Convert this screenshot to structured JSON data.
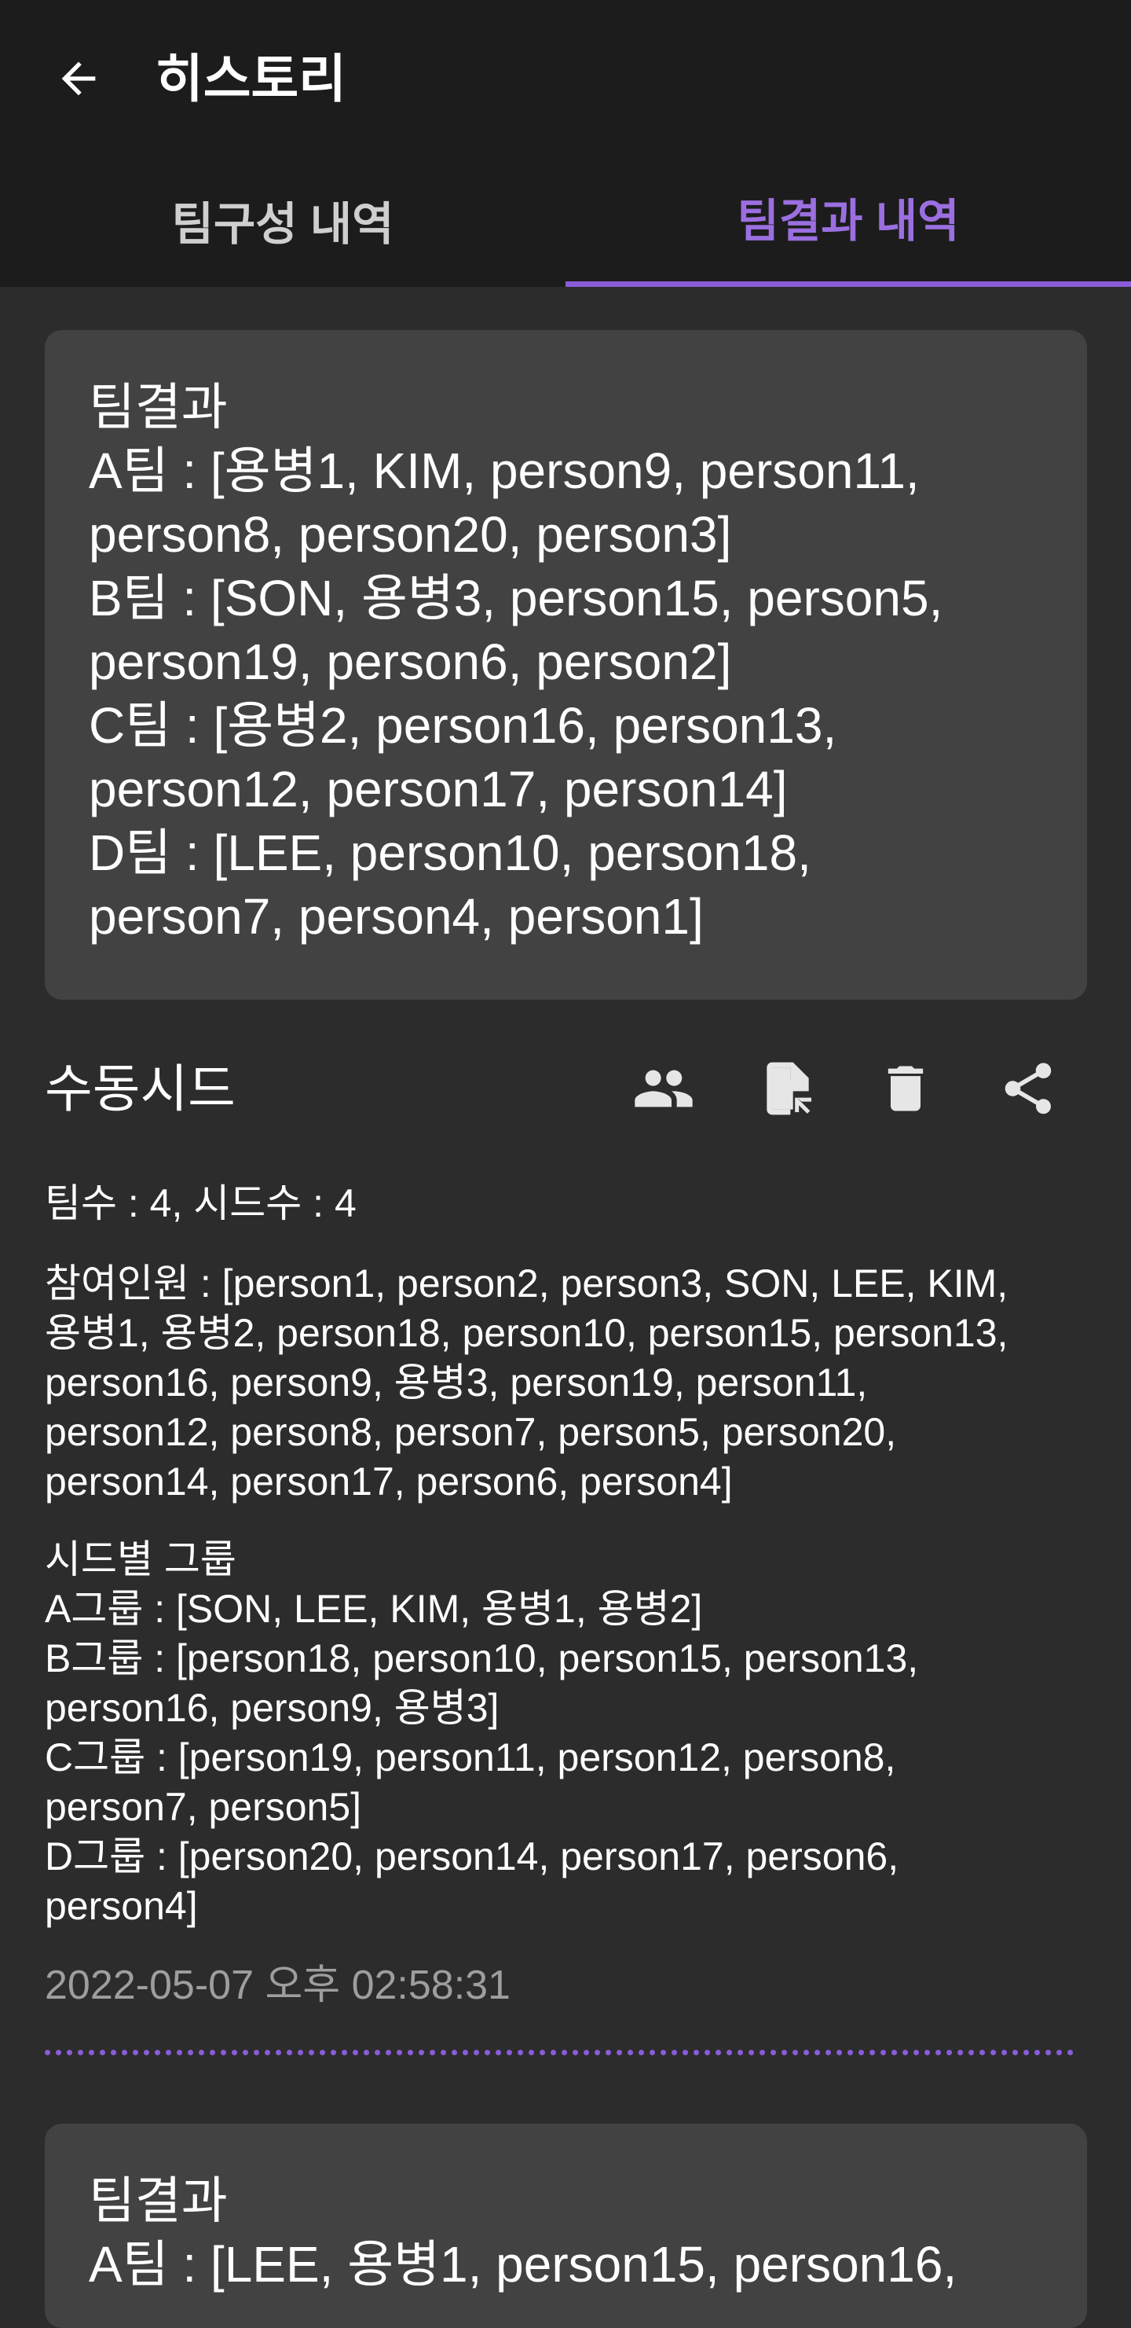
{
  "header": {
    "title": "히스토리",
    "back_icon": "arrow-back-icon"
  },
  "tabs": [
    {
      "label": "팀구성 내역",
      "active": false
    },
    {
      "label": "팀결과 내역",
      "active": true
    }
  ],
  "colors": {
    "accent": "#8a5cd9",
    "background": "#2c2c2c",
    "appbar": "#1c1c1c",
    "card": "#424242"
  },
  "result_card_1": {
    "text": "팀결과\nA팀 : [용병1, KIM, person9, person11,\nperson8, person20, person3]\nB팀 : [SON, 용병3, person15, person5,\nperson19, person6, person2]\nC팀 : [용병2, person16, person13,\nperson12, person17, person14]\nD팀 : [LEE, person10, person18,\nperson7, person4, person1]"
  },
  "section": {
    "title": "수동시드",
    "actions": [
      {
        "name": "group-icon"
      },
      {
        "name": "file-open-icon"
      },
      {
        "name": "delete-icon"
      },
      {
        "name": "share-icon"
      }
    ]
  },
  "info": {
    "counts": "팀수 : 4, 시드수 : 4",
    "participants": "참여인원 : [person1, person2, person3, SON, LEE, KIM,\n용병1, 용병2, person18, person10, person15, person13,\nperson16, person9, 용병3, person19, person11,\nperson12, person8, person7, person5, person20,\nperson14, person17, person6, person4]",
    "groups": "시드별 그룹\nA그룹 : [SON, LEE, KIM, 용병1, 용병2]\nB그룹 : [person18, person10, person15, person13,\nperson16, person9, 용병3]\nC그룹 : [person19, person11, person12, person8,\nperson7, person5]\nD그룹 : [person20, person14, person17, person6,\nperson4]"
  },
  "timestamp": "2022-05-07 오후 02:58:31",
  "result_card_2": {
    "text": "팀결과\nA팀 : [LEE, 용병1, person15, person16,"
  }
}
